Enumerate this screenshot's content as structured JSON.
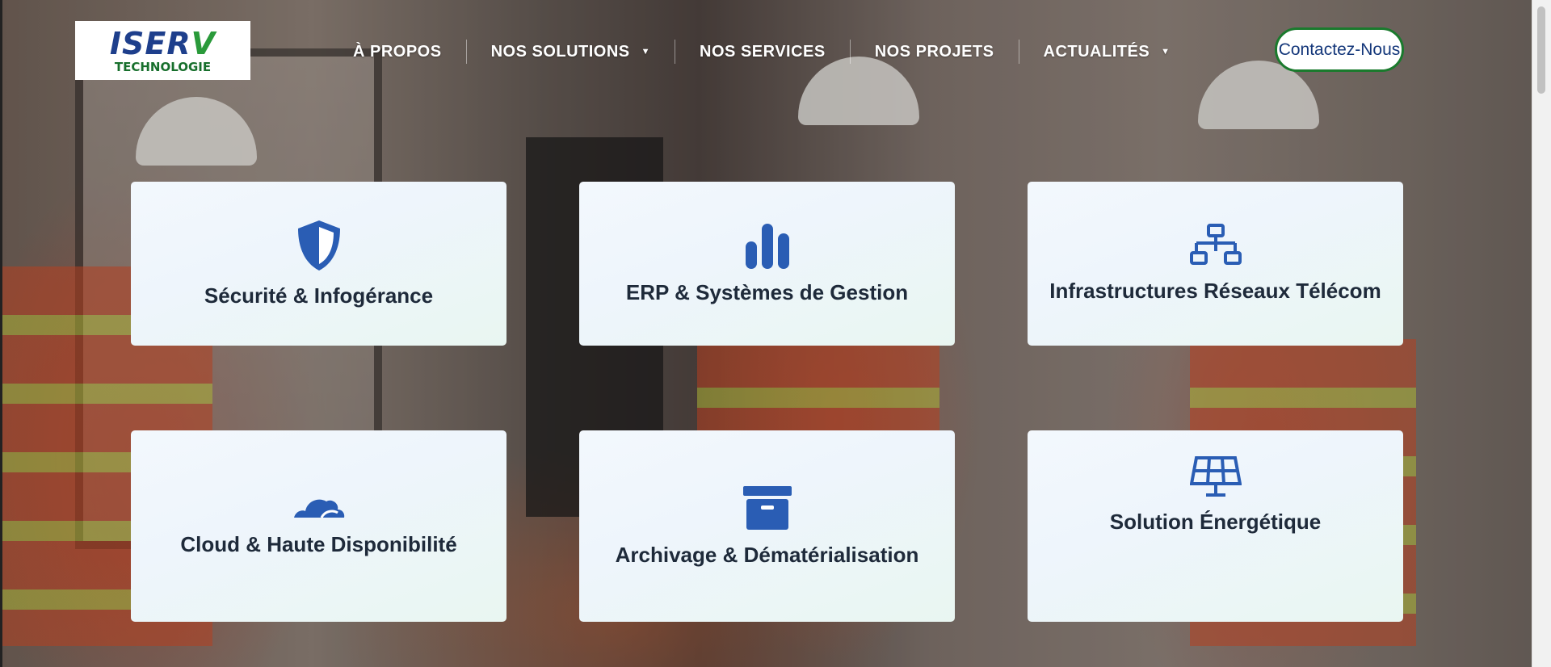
{
  "logo": {
    "brand": "ISERV",
    "subtitle": "TECHNOLOGIE"
  },
  "nav": {
    "items": [
      {
        "label": "À PROPOS",
        "has_dropdown": false
      },
      {
        "label": "NOS SOLUTIONS",
        "has_dropdown": true
      },
      {
        "label": "NOS SERVICES",
        "has_dropdown": false
      },
      {
        "label": "NOS PROJETS",
        "has_dropdown": false
      },
      {
        "label": "ACTUALITÉS",
        "has_dropdown": true
      }
    ],
    "caret_glyph": "▼"
  },
  "cta": {
    "label": "Contactez-Nous"
  },
  "cards": [
    {
      "title": "Sécurité & Infogérance",
      "icon": "shield-icon"
    },
    {
      "title": "ERP & Systèmes de Gestion",
      "icon": "bar-chart-icon"
    },
    {
      "title": "Infrastructures Réseaux Télécom",
      "icon": "network-icon"
    },
    {
      "title": "Cloud & Haute Disponibilité",
      "icon": "cloud-icon"
    },
    {
      "title": "Archivage & Dématérialisation",
      "icon": "archive-box-icon"
    },
    {
      "title": "Solution Énergétique",
      "icon": "solar-panel-icon"
    }
  ],
  "colors": {
    "icon_blue": "#2a5db4",
    "cta_border": "#1a7a2d",
    "cta_text": "#14377a",
    "card_title": "#1e2a3a"
  }
}
